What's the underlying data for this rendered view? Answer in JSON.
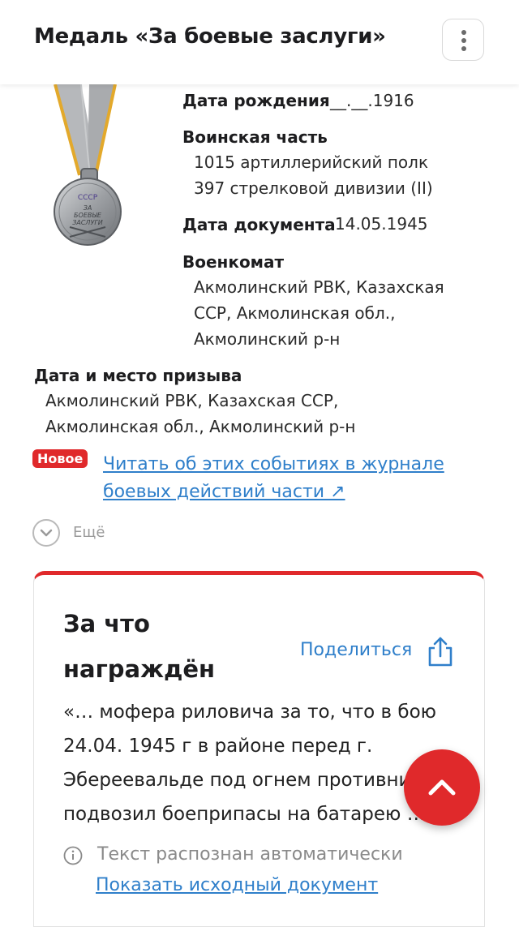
{
  "header": {
    "title": "Медаль «За боевые заслуги»"
  },
  "fields": {
    "birth_date_label": "Дата рождения",
    "birth_date_value": "__.__.1916",
    "unit_label": "Воинская часть",
    "unit_line1": "1015 артиллерийский полк",
    "unit_line2": "397 стрелковой дивизии (II)",
    "doc_date_label": "Дата документа",
    "doc_date_value": "14.05.1945",
    "commissariat_label": "Военкомат",
    "commissariat_line1": "Акмолинский РВК, Казахская",
    "commissariat_line2": "ССР, Акмолинская обл.,",
    "commissariat_line3": "Акмолинский р-н",
    "draft_label": "Дата и место призыва",
    "draft_line1": "Акмолинский РВК, Казахская ССР,",
    "draft_line2": "Акмолинская обл., Акмолинский р-н"
  },
  "medal": {
    "text_line1": "СССР",
    "text_line2": "ЗА",
    "text_line3": "БОЕВЫЕ",
    "text_line4": "ЗАСЛУГИ"
  },
  "new_badge": "Новое",
  "journal_link": "Читать об этих событиях в журнале боевых действий части ↗",
  "more_label": "Ещё",
  "card": {
    "title": "За что награждён",
    "share_label": "Поделиться",
    "reason_text": "«… мофера риловича за то, что в бою 24.04. 1945 г в районе перед г. Эбереевальде под огнем противника подвозил боеприпасы на батарею …",
    "auto_note": "Текст распознан автоматически",
    "show_original_link": "Показать исходный документ"
  },
  "colors": {
    "accent": "#e0292b",
    "link": "#2f7fca",
    "ribbon_gray": "#b6b8bb",
    "ribbon_edge": "#e3a92b"
  }
}
